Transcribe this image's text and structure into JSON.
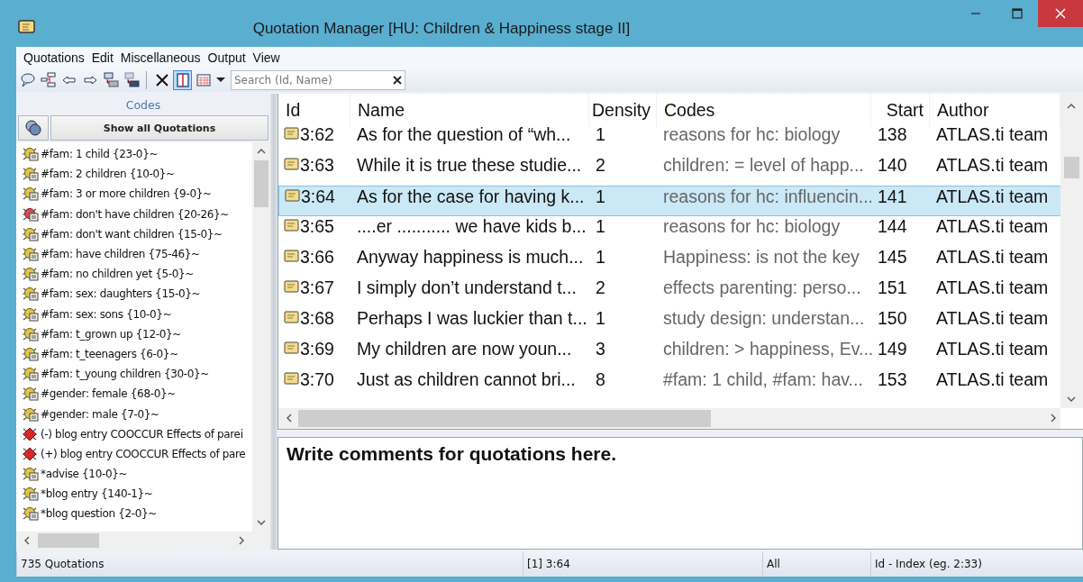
{
  "window": {
    "title": "Quotation Manager [HU: Children & Happiness stage II]"
  },
  "menu": [
    "Quotations",
    "Edit",
    "Miscellaneous",
    "Output",
    "View"
  ],
  "toolbar": [
    {
      "kind": "bubble",
      "selected": false
    },
    {
      "kind": "tree",
      "selected": false
    },
    {
      "kind": "back",
      "selected": false
    },
    {
      "kind": "forward",
      "selected": false
    },
    {
      "kind": "window-out",
      "selected": false
    },
    {
      "kind": "window-in",
      "selected": false
    },
    {
      "kind": "separator"
    },
    {
      "kind": "delete",
      "selected": false
    },
    {
      "kind": "columns",
      "selected": true
    },
    {
      "kind": "grid",
      "selected": false
    },
    {
      "kind": "caret",
      "selected": false
    }
  ],
  "search": {
    "placeholder": "Search (Id, Name)"
  },
  "codes_panel": {
    "title": "Codes",
    "button": "Show all Quotations",
    "items": [
      {
        "kind": "code",
        "label": "#fam: 1 child {23-0}~"
      },
      {
        "kind": "code",
        "label": "#fam: 2 children {10-0}~"
      },
      {
        "kind": "code",
        "label": "#fam: 3 or more children {9-0}~"
      },
      {
        "kind": "flagged",
        "label": "#fam: don't have children {20-26}~"
      },
      {
        "kind": "code",
        "label": "#fam: don't want children {15-0}~"
      },
      {
        "kind": "code",
        "label": "#fam: have children {75-46}~"
      },
      {
        "kind": "code",
        "label": "#fam: no children yet {5-0}~"
      },
      {
        "kind": "code",
        "label": "#fam: sex: daughters {15-0}~"
      },
      {
        "kind": "code",
        "label": "#fam: sex: sons {10-0}~"
      },
      {
        "kind": "code",
        "label": "#fam: t_grown up {12-0}~"
      },
      {
        "kind": "code",
        "label": "#fam: t_teenagers {6-0}~"
      },
      {
        "kind": "code",
        "label": "#fam: t_young children {30-0}~"
      },
      {
        "kind": "code",
        "label": "#gender: female {68-0}~"
      },
      {
        "kind": "code",
        "label": "#gender: male {7-0}~"
      },
      {
        "kind": "cooccur",
        "label": "(-) blog entry COOCCUR Effects of parei"
      },
      {
        "kind": "cooccur",
        "label": "(+) blog entry COOCCUR Effects of pare"
      },
      {
        "kind": "code",
        "label": "*advise {10-0}~"
      },
      {
        "kind": "code",
        "label": "*blog entry {140-1}~"
      },
      {
        "kind": "code",
        "label": "*blog question {2-0}~"
      }
    ]
  },
  "table": {
    "columns": [
      "Id",
      "Name",
      "Density",
      "Codes",
      "Start",
      "Author"
    ],
    "rows": [
      {
        "id": "3:62",
        "name": "As for the question of “wh...",
        "density": "1",
        "codes": "reasons for hc: biology",
        "start": "138",
        "author": "ATLAS.ti team",
        "selected": false
      },
      {
        "id": "3:63",
        "name": "While it is true these studie...",
        "density": "2",
        "codes": "children: = level of happ...",
        "start": "140",
        "author": "ATLAS.ti team",
        "selected": false
      },
      {
        "id": "3:64",
        "name": "As for the case for having k...",
        "density": "1",
        "codes": "reasons for hc: influencin...",
        "start": "141",
        "author": "ATLAS.ti team",
        "selected": true
      },
      {
        "id": "3:65",
        "name": "....er ........... we have kids b...",
        "density": "1",
        "codes": "reasons for hc: biology",
        "start": "144",
        "author": "ATLAS.ti team",
        "selected": false
      },
      {
        "id": "3:66",
        "name": "Anyway happiness is much...",
        "density": "1",
        "codes": "Happiness: is not the key",
        "start": "145",
        "author": "ATLAS.ti team",
        "selected": false
      },
      {
        "id": "3:67",
        "name": "I simply don’t understand t...",
        "density": "2",
        "codes": "effects parenting: perso...",
        "start": "151",
        "author": "ATLAS.ti team",
        "selected": false
      },
      {
        "id": "3:68",
        "name": "Perhaps I was luckier than t...",
        "density": "1",
        "codes": "study design: understan...",
        "start": "150",
        "author": "ATLAS.ti team",
        "selected": false
      },
      {
        "id": "3:69",
        "name": "My children are now youn...",
        "density": "3",
        "codes": "children: > happiness, Ev...",
        "start": "149",
        "author": "ATLAS.ti team",
        "selected": false
      },
      {
        "id": "3:70",
        "name": "Just as children cannot bri...",
        "density": "8",
        "codes": "#fam: 1 child, #fam: hav...",
        "start": "153",
        "author": "ATLAS.ti team",
        "selected": false
      }
    ]
  },
  "comment": {
    "text": "Write comments for quotations here."
  },
  "status_bar": [
    "735 Quotations",
    "[1] 3:64",
    "All",
    "Id - Index (eg. 2:33)"
  ]
}
